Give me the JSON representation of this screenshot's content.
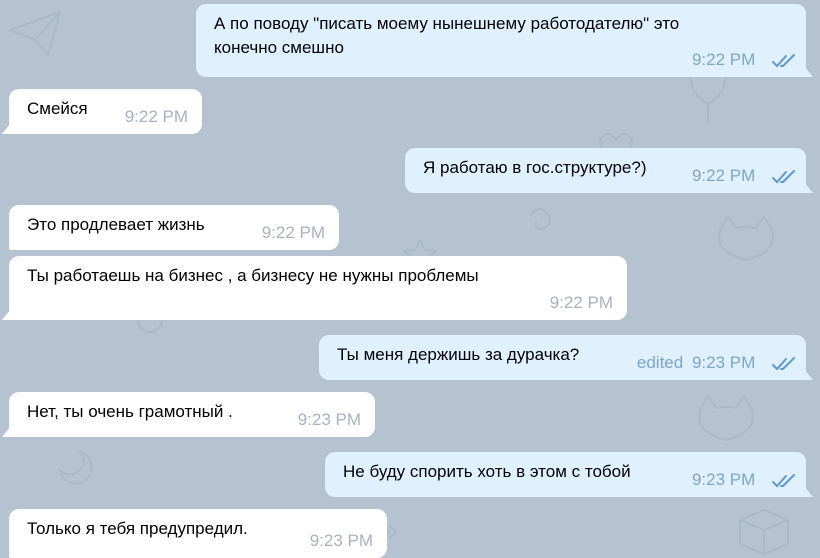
{
  "colors": {
    "background": "#b5c3d0",
    "incoming_bubble": "#ffffff",
    "outgoing_bubble": "#e0f0fe",
    "time_in": "#a9b3bd",
    "time_out": "#7aa6ce"
  },
  "messages": [
    {
      "direction": "out",
      "text": "А по поводу \"писать моему нынешнему работодателю\" это конечно смешно",
      "line1": "А по поводу \"писать моему нынешнему работодателю\" это",
      "line2": "конечно смешно",
      "time": "9:22 PM",
      "read": true
    },
    {
      "direction": "in",
      "text": "Смейся",
      "time": "9:22 PM"
    },
    {
      "direction": "out",
      "text": "Я работаю в гос.структуре?)",
      "time": "9:22 PM",
      "read": true
    },
    {
      "direction": "in",
      "text": "Это продлевает жизнь",
      "time": "9:22 PM"
    },
    {
      "direction": "in",
      "text": "Ты работаешь на бизнес , а бизнесу не нужны проблемы",
      "time": "9:22 PM"
    },
    {
      "direction": "out",
      "text": "Ты меня держишь за дурачка?",
      "edited": "edited",
      "time": "9:23 PM",
      "read": true
    },
    {
      "direction": "in",
      "text": "Нет, ты очень грамотный .",
      "time": "9:23 PM"
    },
    {
      "direction": "out",
      "text": "Не буду спорить хоть в этом с тобой",
      "time": "9:23 PM",
      "read": true
    },
    {
      "direction": "in",
      "text": "Только я тебя предупредил.",
      "time": "9:23 PM"
    }
  ]
}
